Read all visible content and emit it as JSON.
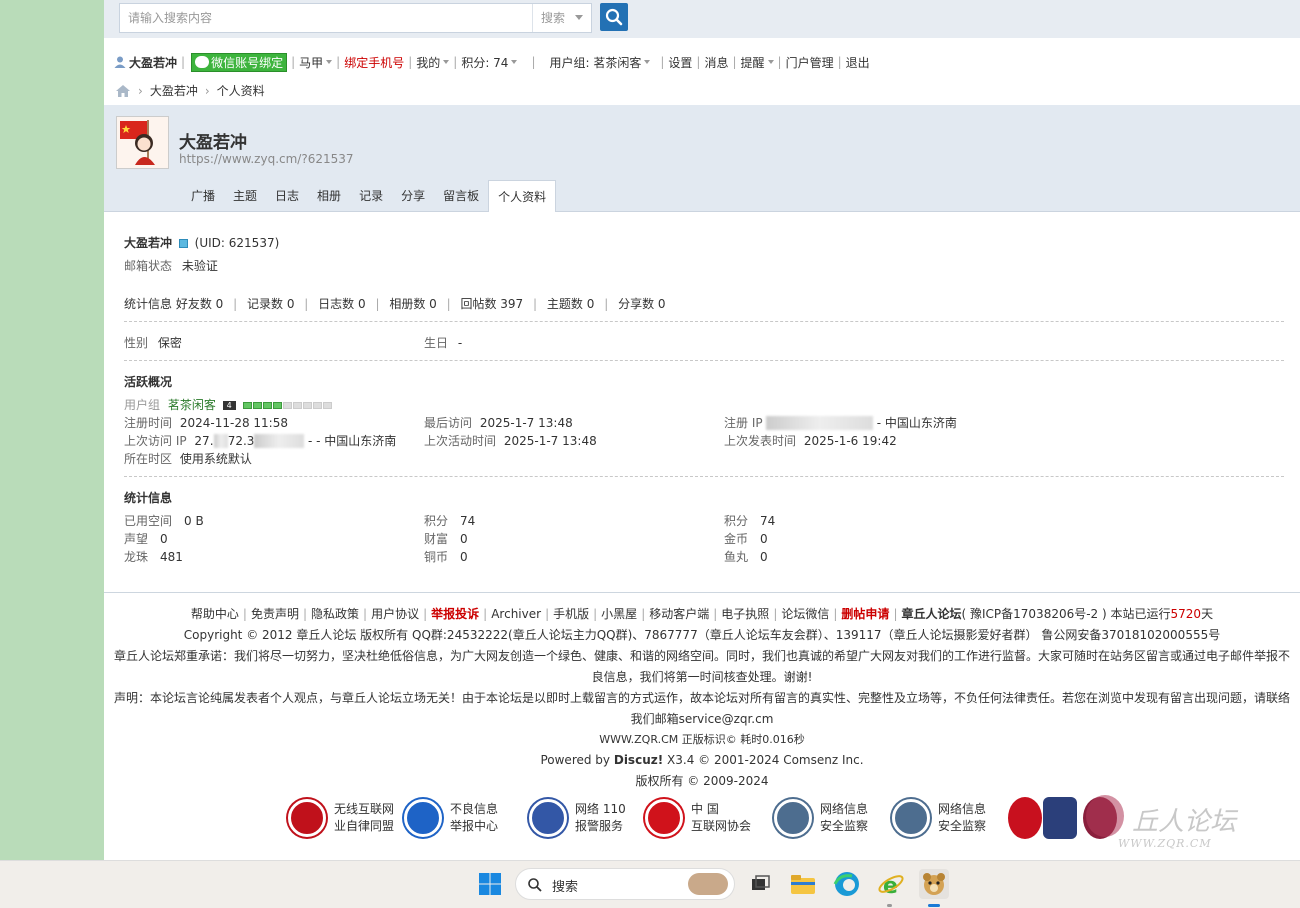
{
  "search": {
    "placeholder": "请输入搜索内容",
    "scope": "搜索"
  },
  "usernav": {
    "username": "大盈若冲",
    "wechat_bind": "微信账号绑定",
    "items": [
      "马甲",
      "绑定手机号",
      "我的",
      "积分: 74",
      "用户组: 茗茶闲客",
      "设置",
      "消息",
      "提醒",
      "门户管理",
      "退出"
    ]
  },
  "breadcrumb": {
    "home": "home-icon",
    "items": [
      "大盈若冲",
      "个人资料"
    ]
  },
  "profile": {
    "name": "大盈若冲",
    "url": "https://www.zyq.cm/?621537",
    "tabs": [
      "广播",
      "主题",
      "日志",
      "相册",
      "记录",
      "分享",
      "留言板",
      "个人资料"
    ],
    "active_tab": "个人资料",
    "uid": "(UID: 621537)",
    "email_status_label": "邮箱状态",
    "email_status": "未验证",
    "stats_label": "统计信息",
    "stats": [
      "好友数 0",
      "记录数 0",
      "日志数 0",
      "相册数 0",
      "回帖数 397",
      "主题数 0",
      "分享数 0"
    ],
    "gender_label": "性别",
    "gender": "保密",
    "birthday_label": "生日",
    "birthday": "-"
  },
  "activity": {
    "title": "活跃概况",
    "group_label": "用户组",
    "group": "茗茶闲客",
    "group_level": "4",
    "level_filled_fraction": 0.4,
    "reg_time_label": "注册时间",
    "reg_time": "2024-11-28 11:58",
    "last_visit_label": "最后访问",
    "last_visit": "2025-1-7 13:48",
    "reg_ip_label": "注册 IP",
    "reg_ip_suffix": "- 中国山东济南",
    "prev_visit_ip_label": "上次访问 IP",
    "prev_visit_ip_prefix": "27.",
    "prev_visit_ip_mid": "72.3",
    "prev_visit_ip_suffix": "- - 中国山东济南",
    "last_active_label": "上次活动时间",
    "last_active": "2025-1-7 13:48",
    "last_post_label": "上次发表时间",
    "last_post": "2025-1-6 19:42",
    "timezone_label": "所在时区",
    "timezone": "使用系统默认"
  },
  "statistics": {
    "title": "统计信息",
    "rows": [
      [
        {
          "label": "已用空间",
          "value": "0 B"
        },
        {
          "label": "积分",
          "value": "74"
        },
        {
          "label": "积分",
          "value": "74"
        }
      ],
      [
        {
          "label": "声望",
          "value": "0"
        },
        {
          "label": "财富",
          "value": "0"
        },
        {
          "label": "金币",
          "value": "0"
        }
      ],
      [
        {
          "label": "龙珠",
          "value": "481"
        },
        {
          "label": "铜币",
          "value": "0"
        },
        {
          "label": "鱼丸",
          "value": "0"
        }
      ]
    ]
  },
  "footer": {
    "links": [
      "帮助中心",
      "免责声明",
      "隐私政策",
      "用户协议",
      "举报投诉",
      "Archiver",
      "手机版",
      "小黑屋",
      "移动客户端",
      "电子执照",
      "论坛微信",
      "删帖申请",
      "章丘人论坛"
    ],
    "icp": "( 豫ICP备17038206号-2 ) 本站已运行",
    "days": "5720",
    "days_suffix": "天",
    "copyright": "Copyright © 2012 章丘人论坛 版权所有 QQ群:24532222(章丘人论坛主力QQ群)、7867777（章丘人论坛车友会群）、139117（章丘人论坛摄影爱好者群） 鲁公网安备37018102000555号",
    "promise": "章丘人论坛郑重承诺：我们将尽一切努力，坚决杜绝低俗信息，为广大网友创造一个绿色、健康、和谐的网络空间。同时，我们也真诚的希望广大网友对我们的工作进行监督。大家可随时在站务区留言或通过电子邮件举报不良信息，我们将第一时间核查处理。谢谢!",
    "disclaimer": "声明：本论坛言论纯属发表者个人观点，与章丘人论坛立场无关！由于本论坛是以即时上载留言的方式运作，故本论坛对所有留言的真实性、完整性及立场等，不负任何法律责任。若您在浏览中发现有留言出现问题，请联络我们邮箱service@zqr.cm",
    "site_id": "WWW.ZQR.CM 正版标识© 耗时0.016秒",
    "powered": "Powered by",
    "discuz": "Discuz!",
    "powered_suffix": "X3.4 © 2001-2024 Comsenz Inc.",
    "rights": "版权所有 © 2009-2024"
  },
  "badges": [
    {
      "line1": "无线互联网",
      "line2": "业自律同盟",
      "color": "#c0111b"
    },
    {
      "line1": "不良信息",
      "line2": "举报中心",
      "color": "#1e63c6"
    },
    {
      "line1": "网络 110",
      "line2": "报警服务",
      "color": "#3357a6"
    },
    {
      "line1": "中    国",
      "line2": "互联网协会",
      "color": "#d0121b"
    },
    {
      "line1": "网络信息",
      "line2": "安全监察",
      "color": "#4d6d8f"
    },
    {
      "line1": "网络信息",
      "line2": "安全监察",
      "color": "#4d6d8f"
    }
  ],
  "watermark": {
    "text": "丘人论坛",
    "sub": "WWW.ZQR.CM"
  },
  "taskbar": {
    "search_label": "搜索"
  },
  "colors": {
    "sidebar": "#b9dcb9",
    "accent": "#2371b4",
    "red": "#cc0000",
    "wechat": "#3db43d"
  }
}
